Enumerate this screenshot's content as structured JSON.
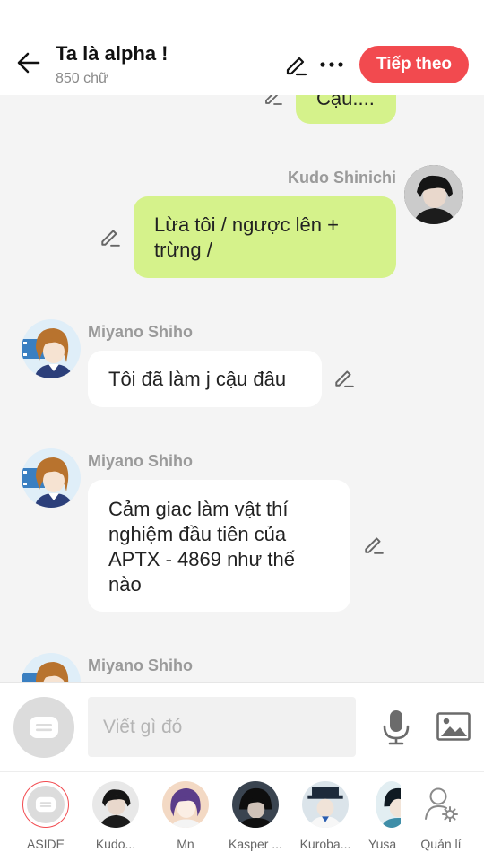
{
  "header": {
    "title": "Ta là alpha !",
    "word_count": "850 chữ",
    "next_label": "Tiếp theo",
    "accent_color": "#f24a4f"
  },
  "messages": [
    {
      "side": "right",
      "sender": "",
      "lines": [
        "Cậu...."
      ]
    },
    {
      "side": "right",
      "sender": "Kudo Shinichi",
      "lines": [
        "Lừa tôi / ngược lên +",
        "trừng /"
      ]
    },
    {
      "side": "left",
      "sender": "Miyano Shiho",
      "lines": [
        "Tôi đã làm j cậu đâu"
      ]
    },
    {
      "side": "left",
      "sender": "Miyano Shiho",
      "lines": [
        "Cảm giac làm vật thí",
        "nghiệm đầu tiên của",
        "APTX - 4869 như thế",
        "nào"
      ]
    },
    {
      "side": "left",
      "sender": "Miyano Shiho",
      "lines": []
    }
  ],
  "composer": {
    "placeholder": "Viết gì đó"
  },
  "characters": [
    {
      "label": "ASIDE",
      "icon": "aside-icon"
    },
    {
      "label": "Kudo...",
      "icon": "avatar"
    },
    {
      "label": "Mn",
      "icon": "avatar"
    },
    {
      "label": "Kasper ...",
      "icon": "avatar"
    },
    {
      "label": "Kuroba...",
      "icon": "avatar"
    },
    {
      "label": "Yusa",
      "icon": "avatar"
    },
    {
      "label": "Quản lí",
      "icon": "manage-user-icon"
    }
  ]
}
